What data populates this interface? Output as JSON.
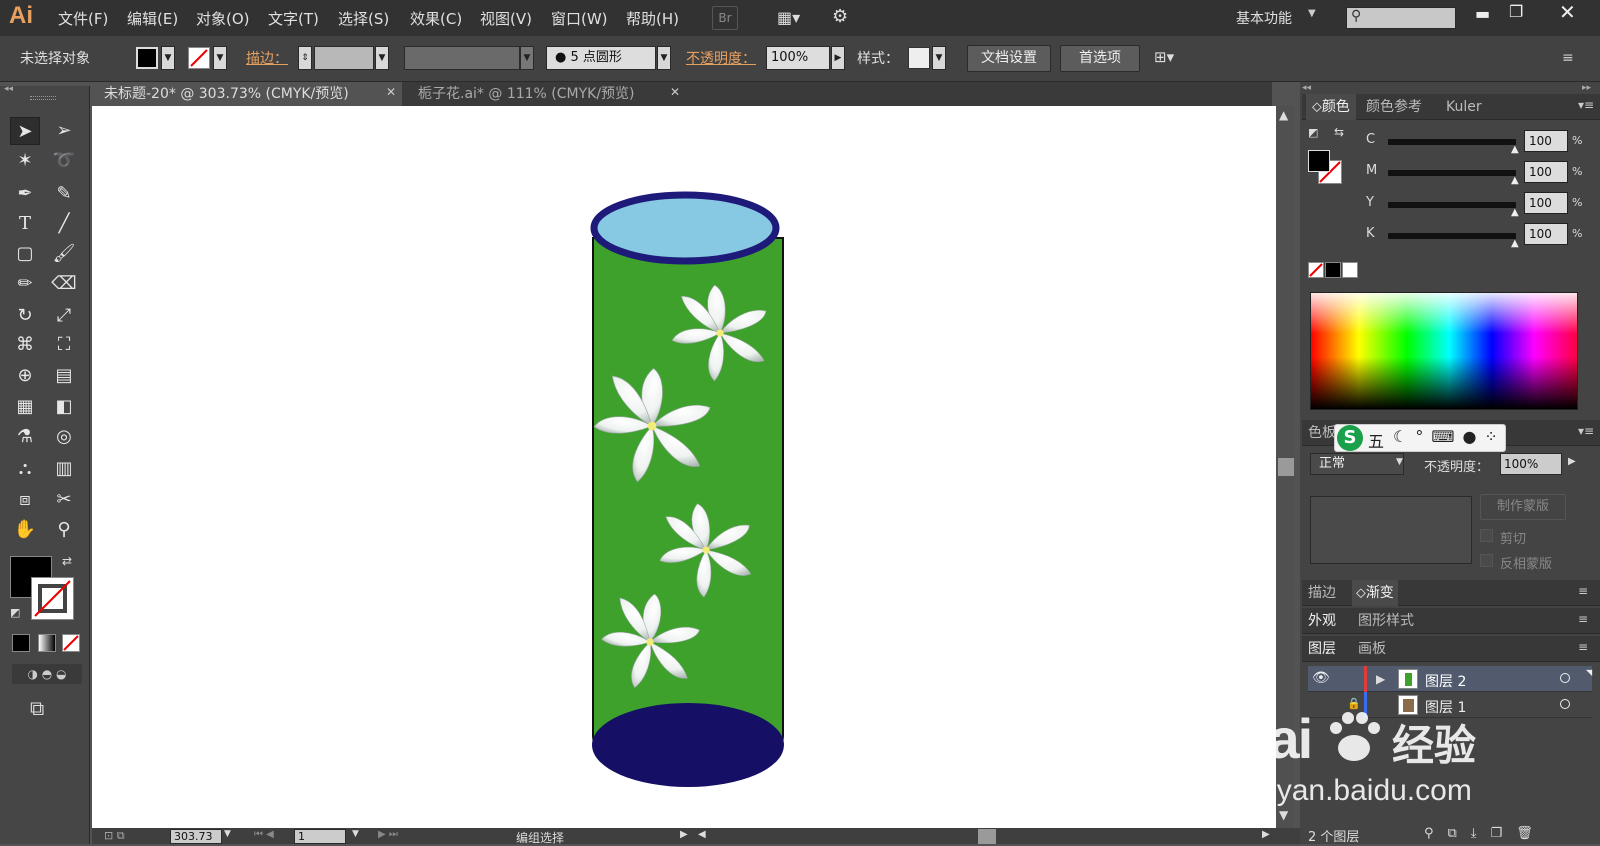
{
  "app": {
    "logo": "Ai",
    "workspace": "基本功能"
  },
  "menu": [
    "文件(F)",
    "编辑(E)",
    "对象(O)",
    "文字(T)",
    "选择(S)",
    "效果(C)",
    "视图(V)",
    "窗口(W)",
    "帮助(H)"
  ],
  "menubar": {
    "bridge": "Br"
  },
  "control": {
    "status": "未选择对象",
    "stroke_label": "描边：",
    "brush": "5 点圆形",
    "opacity_label": "不透明度：",
    "opacity_value": "100%",
    "style_label": "样式：",
    "doc_setup": "文档设置",
    "prefs": "首选项"
  },
  "tabs": [
    {
      "label": "未标题-20* @ 303.73% (CMYK/预览)"
    },
    {
      "label": "栀子花.ai* @ 111% (CMYK/预览)"
    }
  ],
  "color_panel": {
    "tabs": [
      "颜色",
      "颜色参考",
      "Kuler"
    ],
    "channels": [
      {
        "name": "C",
        "value": "100"
      },
      {
        "name": "M",
        "value": "100"
      },
      {
        "name": "Y",
        "value": "100"
      },
      {
        "name": "K",
        "value": "100"
      }
    ],
    "pct": "%"
  },
  "transparency": {
    "tab_partial": "色板",
    "ime": "五",
    "blend": "正常",
    "opacity_label": "不透明度：",
    "opacity_value": "100%",
    "make_mask": "制作蒙版",
    "clip": "剪切",
    "invert": "反相蒙版"
  },
  "stroke_gradient": {
    "tabs": [
      "描边",
      "渐变"
    ]
  },
  "appearance": {
    "tabs": [
      "外观",
      "图形样式"
    ]
  },
  "layers": {
    "tabs": [
      "图层",
      "画板"
    ],
    "items": [
      {
        "name": "图层 2"
      },
      {
        "name": "图层 1"
      }
    ],
    "count": "2 个图层"
  },
  "status": {
    "zoom": "303.73",
    "page": "1",
    "mode": "编组选择"
  },
  "watermark": {
    "brand": "Bai",
    "brand2": "经验",
    "url": "jingyan.baidu.com"
  },
  "colors": {
    "accent": "#e8a060",
    "cup_green": "#3da12b",
    "cup_top": "#87c8e2",
    "cup_rim": "#1e1a7a",
    "cup_bottom": "#150f66"
  }
}
